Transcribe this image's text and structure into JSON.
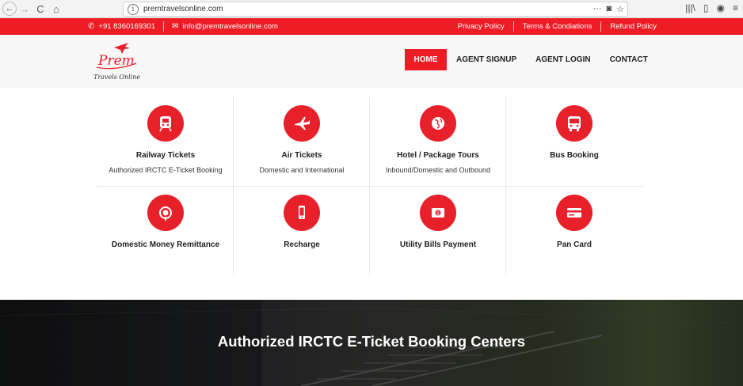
{
  "browser": {
    "url": "premtravelsonline.com",
    "back_icon": "←",
    "forward_icon": "→",
    "reload_icon": "C",
    "home_icon": "⌂",
    "more_icon": "···",
    "pocket_icon": "◙",
    "star_icon": "☆",
    "library_icon": "|||\\",
    "sidebar_icon": "▯",
    "account_icon": "◉",
    "menu_icon": "≡"
  },
  "topbar": {
    "phone": "+91 8360169301",
    "email": "info@premtravelsonline.com",
    "links": [
      "Privacy Policy",
      "Terms & Condiations",
      "Refund Policy"
    ]
  },
  "logo": {
    "name": "Prem",
    "tagline": "Travels Online"
  },
  "nav": {
    "items": [
      "HOME",
      "AGENT SIGNUP",
      "AGENT LOGIN",
      "CONTACT"
    ]
  },
  "services": [
    {
      "title": "Railway Tickets",
      "subtitle": "Authorized IRCTC E-Ticket Booking",
      "icon": "train-icon"
    },
    {
      "title": "Air Tickets",
      "subtitle": "Domestic and International",
      "icon": "plane-icon"
    },
    {
      "title": "Hotel / Package Tours",
      "subtitle": "Inbound/Domestic and Outbound",
      "icon": "globe-icon"
    },
    {
      "title": "Bus Booking",
      "subtitle": "",
      "icon": "bus-icon"
    },
    {
      "title": "Domestic Money Remittance",
      "subtitle": "",
      "icon": "money-bag-icon"
    },
    {
      "title": "Recharge",
      "subtitle": "",
      "icon": "mobile-phone-icon"
    },
    {
      "title": "Utility Bills Payment",
      "subtitle": "",
      "icon": "banknote-icon"
    },
    {
      "title": "Pan Card",
      "subtitle": "",
      "icon": "card-icon"
    }
  ],
  "banner": {
    "title": "Authorized IRCTC E-Ticket Booking Centers"
  },
  "colors": {
    "brand_red": "#ee1c25"
  }
}
